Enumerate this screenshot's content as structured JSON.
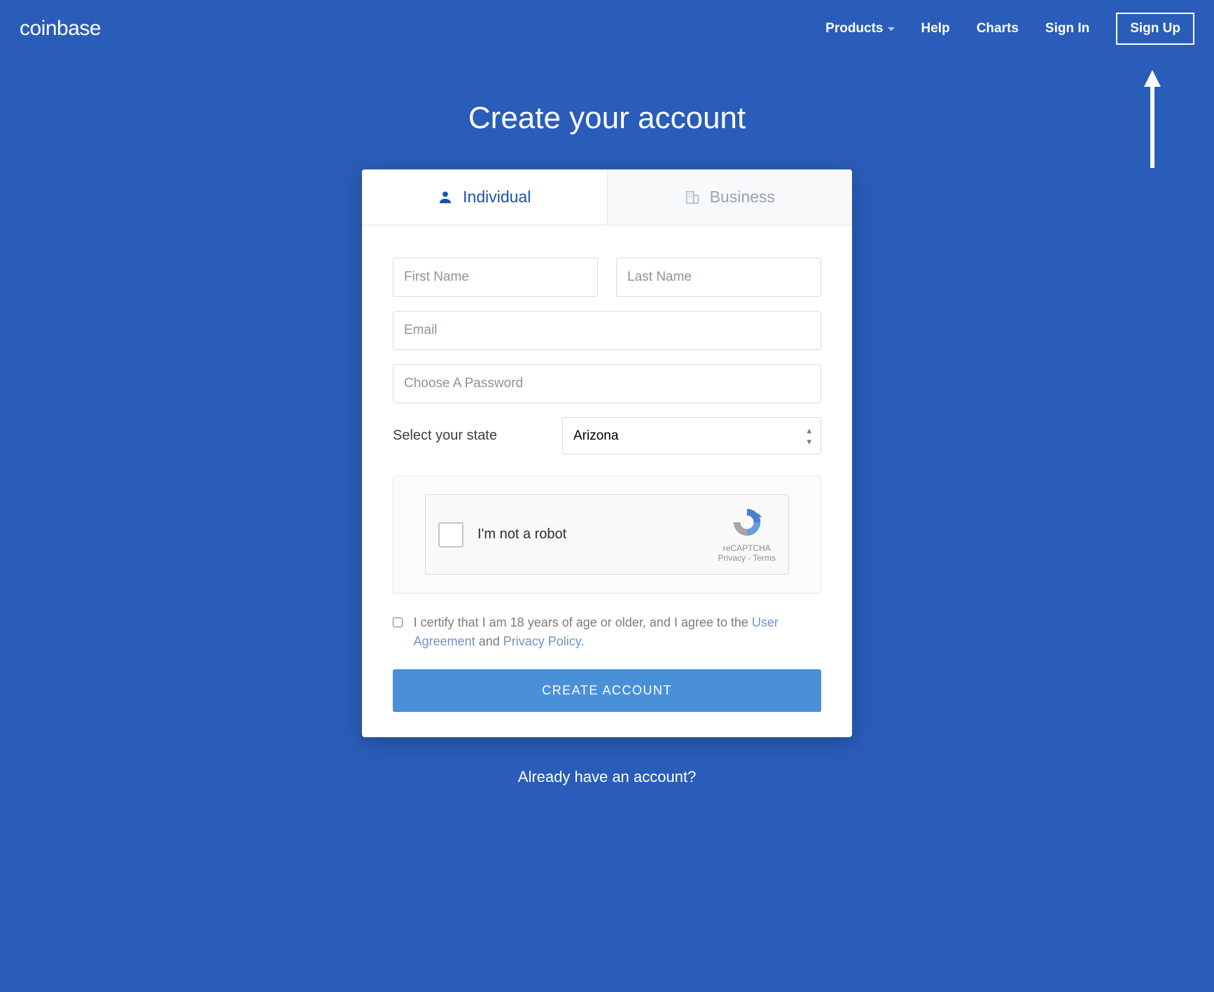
{
  "brand": "coinbase",
  "nav": {
    "products": "Products",
    "help": "Help",
    "charts": "Charts",
    "signin": "Sign In",
    "signup": "Sign Up"
  },
  "page_title": "Create your account",
  "tabs": {
    "individual": "Individual",
    "business": "Business"
  },
  "form": {
    "first_name_placeholder": "First Name",
    "last_name_placeholder": "Last Name",
    "email_placeholder": "Email",
    "password_placeholder": "Choose A Password",
    "state_label": "Select your state",
    "state_value": "Arizona"
  },
  "captcha": {
    "text": "I'm not a robot",
    "brand": "reCAPTCHA",
    "privacy": "Privacy",
    "terms": "Terms",
    "dash": " - "
  },
  "certify": {
    "prefix": "I certify that I am 18 years of age or older, and I agree to the ",
    "user_agreement": "User Agreement",
    "and": " and ",
    "privacy_policy": "Privacy Policy",
    "suffix": "."
  },
  "submit": "CREATE ACCOUNT",
  "footer": "Already have an account?"
}
